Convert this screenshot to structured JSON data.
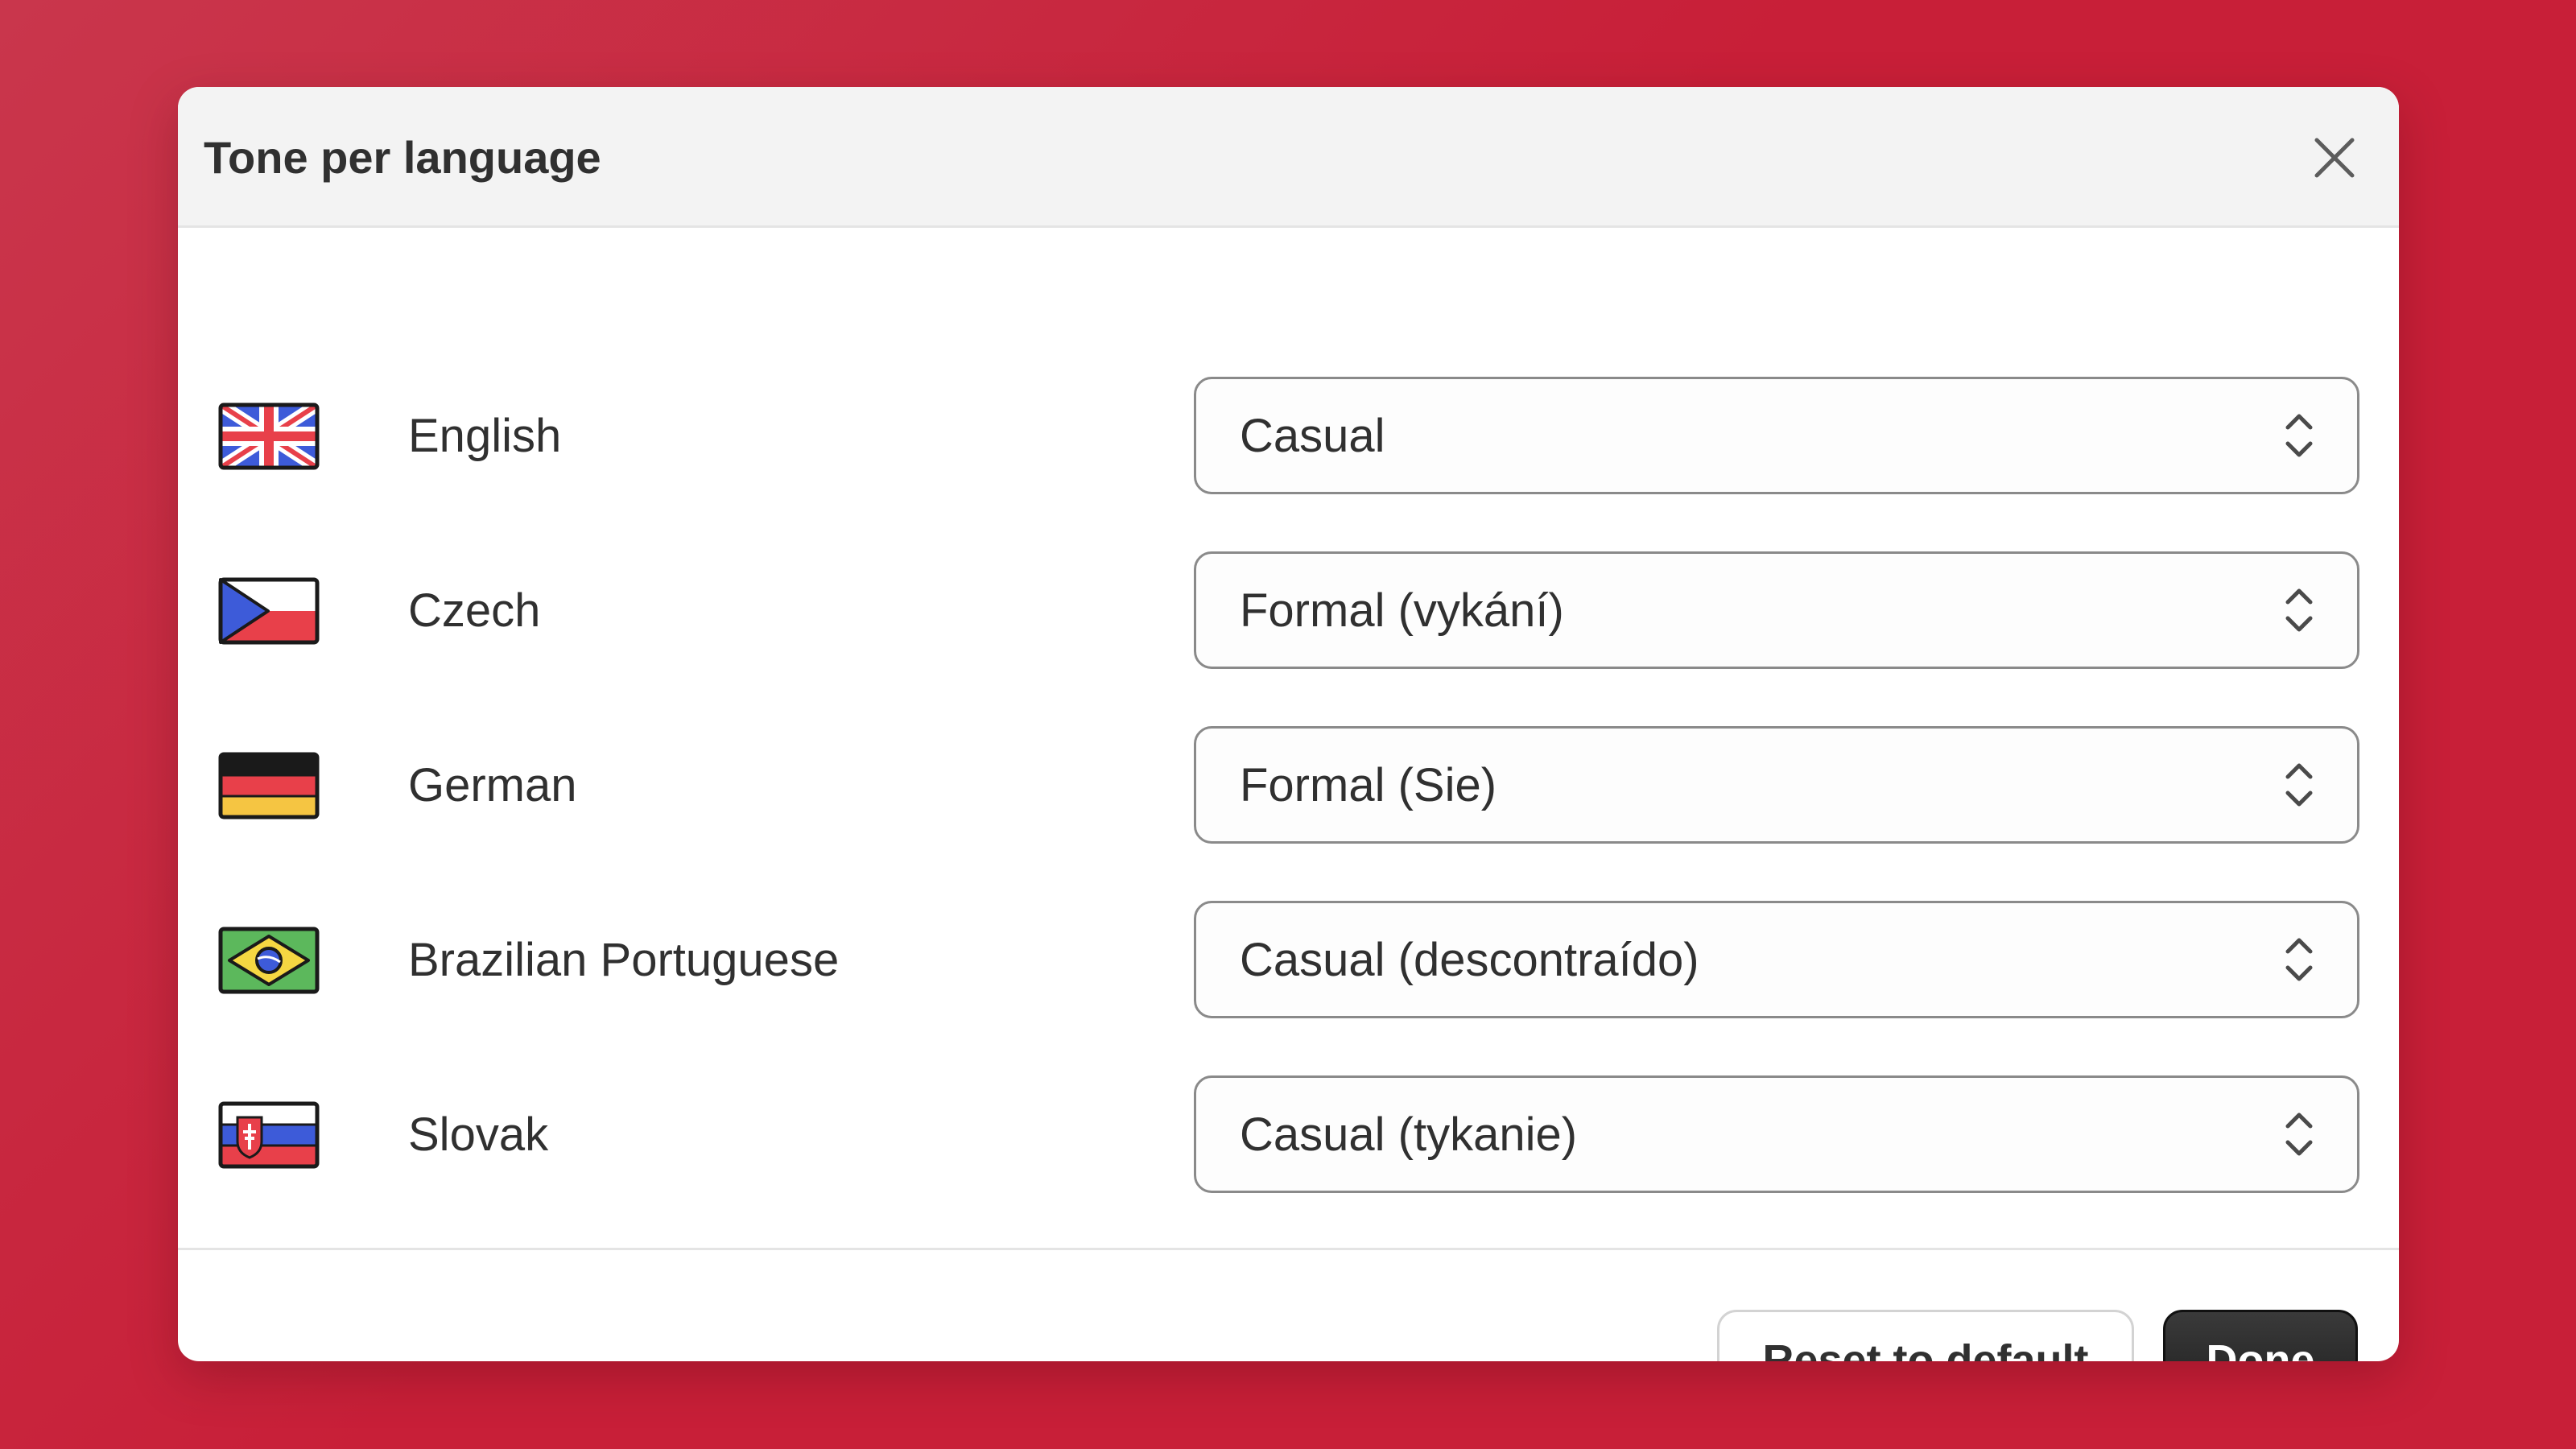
{
  "dialog": {
    "title": "Tone per language",
    "close_icon": "close-icon"
  },
  "languages": [
    {
      "flag_icon": "uk-flag-icon",
      "name": "English",
      "tone": "Casual"
    },
    {
      "flag_icon": "czech-flag-icon",
      "name": "Czech",
      "tone": "Formal (vykání)"
    },
    {
      "flag_icon": "german-flag-icon",
      "name": "German",
      "tone": "Formal (Sie)"
    },
    {
      "flag_icon": "brazil-flag-icon",
      "name": "Brazilian Portuguese",
      "tone": "Casual (descontraído)"
    },
    {
      "flag_icon": "slovak-flag-icon",
      "name": "Slovak",
      "tone": "Casual (tykanie)"
    }
  ],
  "footer": {
    "reset_label": "Reset to default",
    "done_label": "Done"
  },
  "colors": {
    "background": "#c81f38",
    "header_bg": "#f3f3f3",
    "primary_button": "#262626"
  }
}
